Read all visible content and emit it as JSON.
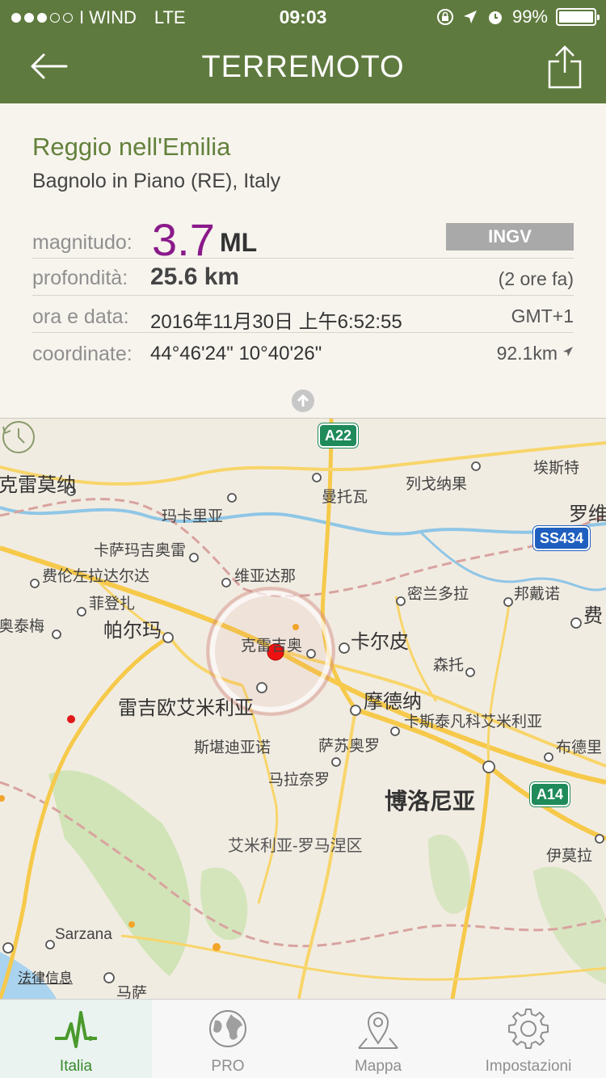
{
  "status": {
    "carrier": "I WIND",
    "network": "LTE",
    "time": "09:03",
    "battery": "99%",
    "signal_bars": 3
  },
  "nav": {
    "title": "TERREMOTO"
  },
  "quake": {
    "city": "Reggio nell'Emilia",
    "region": "Bagnolo in Piano (RE), Italy",
    "magnitude_label": "magnitudo:",
    "magnitude": "3.7",
    "magnitude_unit": "ML",
    "source": "INGV",
    "depth_label": "profondità:",
    "depth": "25.6 km",
    "ago": "(2 ore fa)",
    "datetime_label": "ora e data:",
    "datetime": "2016年11月30日 上午6:52:55",
    "timezone": "GMT+1",
    "coord_label": "coordinate:",
    "coords": "44°46'24\"  10°40'26\"",
    "distance": "92.1km"
  },
  "map": {
    "places": [
      "克雷莫纳",
      "曼托瓦",
      "列戈纳果",
      "埃斯特",
      "罗维",
      "玛卡里亚",
      "卡萨玛吉奥雷",
      "费伦左拉达尔达",
      "维亚达那",
      "密兰多拉",
      "邦戴诺",
      "费",
      "菲登扎",
      "帕尔玛",
      "奥泰梅",
      "克雷吉奥",
      "卡尔皮",
      "森托",
      "摩德纳",
      "雷吉欧艾米利亚",
      "卡斯泰凡科艾米利亚",
      "布德里",
      "斯堪迪亚诺",
      "萨苏奥罗",
      "马拉奈罗",
      "博洛尼亚",
      "艾米利亚-罗马涅区",
      "伊莫拉",
      "Sarzana",
      "马萨"
    ],
    "shields": [
      "A22",
      "SS434",
      "A14"
    ],
    "legal": "法律信息"
  },
  "tabs": [
    {
      "label": "Italia",
      "icon": "pulse-icon"
    },
    {
      "label": "PRO",
      "icon": "globe-icon"
    },
    {
      "label": "Mappa",
      "icon": "map-pin-icon"
    },
    {
      "label": "Impostazioni",
      "icon": "gear-icon"
    }
  ],
  "colors": {
    "header": "#5f7a3e",
    "accent": "#63813b",
    "magnitude": "#8a1a8a",
    "epicenter": "#ee1111"
  }
}
